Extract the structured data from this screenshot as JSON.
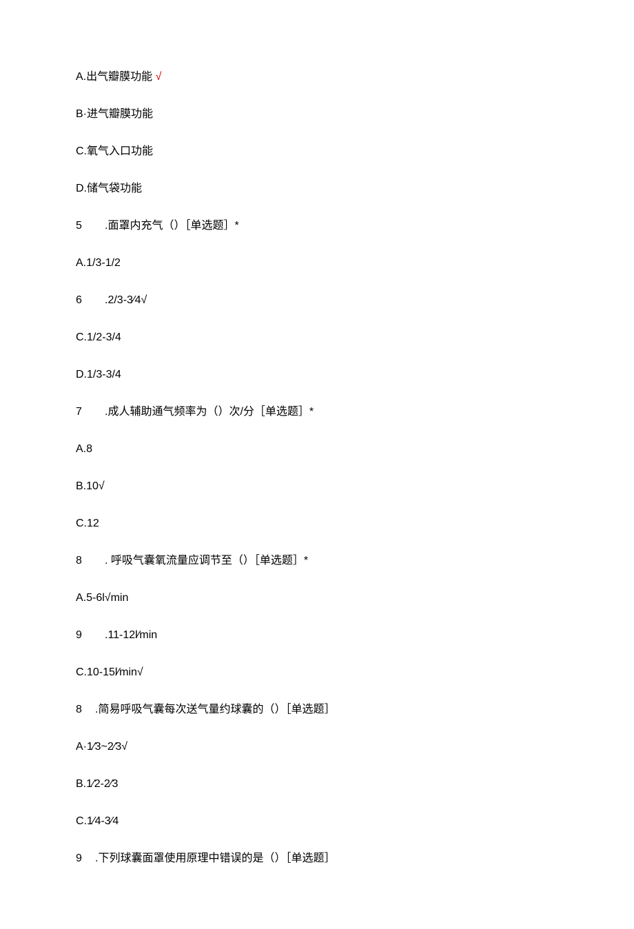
{
  "lines": [
    {
      "text": "A.出气瓣膜功能 ",
      "check": "√"
    },
    {
      "text": "B·进气瓣膜功能"
    },
    {
      "text": "C.氧气入口功能"
    },
    {
      "text": "D.储气袋功能"
    },
    {
      "num": "5",
      "rest": ".面罩内充气（）［单选题］*"
    },
    {
      "text": "A.1/3-1/2"
    },
    {
      "num": "6",
      "rest": ".2/3-3⁄4√"
    },
    {
      "text": "C.1/2-3/4"
    },
    {
      "text": "D.1/3-3/4"
    },
    {
      "num": "7",
      "rest": ".成人辅助通气频率为（）次/分［单选题］*"
    },
    {
      "text": "A.8"
    },
    {
      "text": "B.10√"
    },
    {
      "text": "C.12"
    },
    {
      "num": "8",
      "rest": ". 呼吸气囊氧流量应调节至（）［单选题］*"
    },
    {
      "text": "A.5-6l√min"
    },
    {
      "num": "9",
      "rest": ".11-12l⁄min"
    },
    {
      "text": "C.10-15l⁄min√"
    },
    {
      "num2": "8",
      "rest": ".简易呼吸气囊每次送气量约球囊的（）［单选题］"
    },
    {
      "text": "A·1⁄3~2⁄3√"
    },
    {
      "text": "B.1⁄2-2⁄3"
    },
    {
      "text": "C.1⁄4-3⁄4"
    },
    {
      "num2": "9",
      "rest": ".下列球囊面罩使用原理中错误的是（）［单选题］"
    }
  ]
}
